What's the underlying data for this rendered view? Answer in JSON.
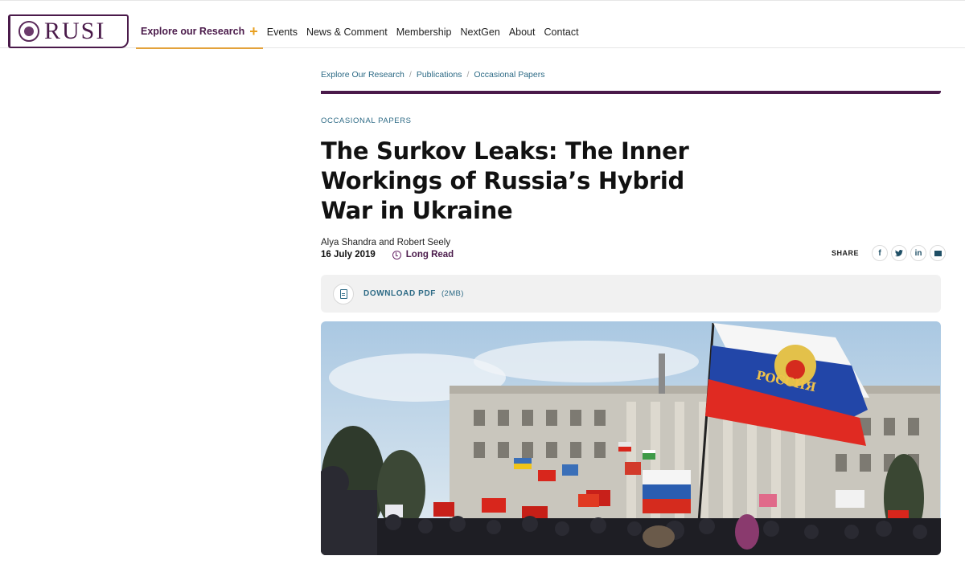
{
  "header": {
    "logo_text": "RUSI",
    "nav": [
      {
        "label": "Explore our Research",
        "active": true
      },
      {
        "label": "Events"
      },
      {
        "label": "News & Comment"
      },
      {
        "label": "Membership"
      },
      {
        "label": "NextGen"
      },
      {
        "label": "About"
      },
      {
        "label": "Contact"
      }
    ],
    "expand_icon": "plus-icon"
  },
  "breadcrumb": [
    "Explore Our Research",
    "Publications",
    "Occasional Papers"
  ],
  "article": {
    "category": "OCCASIONAL PAPERS",
    "title": "The Surkov Leaks: The Inner Workings of Russia’s Hybrid War in Ukraine",
    "authors": "Alya Shandra and Robert Seely",
    "date": "16 July 2019",
    "read_type": "Long Read"
  },
  "share": {
    "label": "SHARE",
    "buttons": [
      "facebook-icon",
      "twitter-icon",
      "linkedin-icon",
      "email-icon"
    ]
  },
  "download": {
    "label": "DOWNLOAD PDF",
    "size": "(2MB)"
  },
  "hero": {
    "flag_text": "РОССИЯ"
  },
  "colors": {
    "brand_purple": "#4a1a4a",
    "link_blue": "#2e6b86",
    "accent_orange": "#e8a020"
  }
}
